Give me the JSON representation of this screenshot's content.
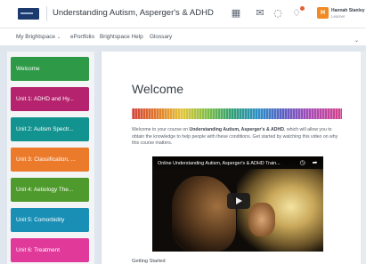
{
  "header": {
    "course_title": "Understanding Autism, Asperger's & ADHD",
    "user": {
      "initials": "H",
      "name": "Hannah Stanley",
      "role": "Learner"
    },
    "icons": [
      "grid-icon",
      "mail-icon",
      "chat-icon",
      "bell-icon"
    ]
  },
  "nav": {
    "items": [
      {
        "label": "My Brightspace",
        "has_dropdown": true
      },
      {
        "label": "ePortfolio"
      },
      {
        "label": "Brightspace Help"
      },
      {
        "label": "Glossary"
      }
    ]
  },
  "toc": {
    "units": [
      {
        "label": "Welcome",
        "color": "#2e9a47"
      },
      {
        "label": "Unit 1: ADHD and Hy...",
        "color": "#b5226e"
      },
      {
        "label": "Unit 2: Autism Spectr...",
        "color": "#12938f"
      },
      {
        "label": "Unit 3: Classification, ...",
        "color": "#ec7a2b"
      },
      {
        "label": "Unit 4: Aetiology The...",
        "color": "#4f9a2d"
      },
      {
        "label": "Unit 5: Comorbidity",
        "color": "#1a8fb6"
      },
      {
        "label": "Unit 6: Treatment",
        "color": "#e0399a"
      }
    ]
  },
  "main": {
    "title": "Welcome",
    "intro_pre": "Welcome to your course on ",
    "intro_bold": "Understanding Autism, Asperger's & ADHD",
    "intro_post": ", which will allow you to obtain the knowledge to help people with these conditions. Get started by watching this video on why this course matters.",
    "video": {
      "title": "Online Understanding Autism, Asperger's & ADHD Train..."
    },
    "section_heading": "Getting Started"
  }
}
